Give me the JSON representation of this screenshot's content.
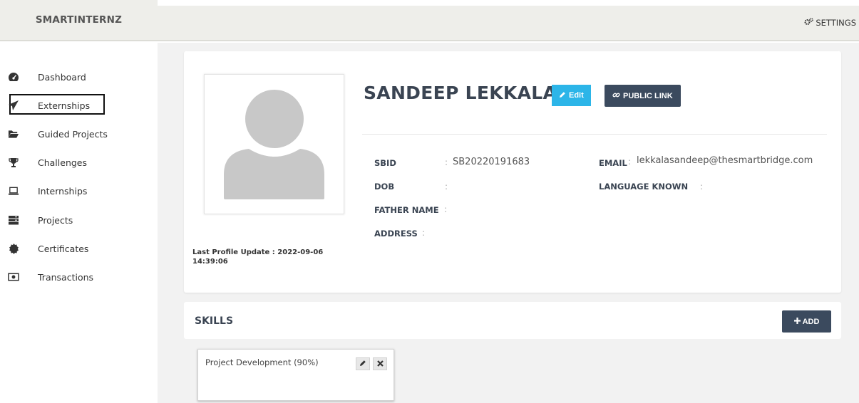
{
  "brand": "SMARTINTERNZ",
  "settings_label": "SETTINGS",
  "nav": [
    {
      "label": "Dashboard",
      "icon": "dashboard-icon"
    },
    {
      "label": "Externships",
      "icon": "paper-plane-icon"
    },
    {
      "label": "Guided Projects",
      "icon": "folder-open-icon"
    },
    {
      "label": "Challenges",
      "icon": "trophy-icon"
    },
    {
      "label": "Internships",
      "icon": "laptop-icon"
    },
    {
      "label": "Projects",
      "icon": "server-icon"
    },
    {
      "label": "Certificates",
      "icon": "badge-icon"
    },
    {
      "label": "Transactions",
      "icon": "money-icon"
    }
  ],
  "active_nav": "Externships",
  "profile": {
    "name": "SANDEEP LEKKALA",
    "edit_label": "Edit",
    "public_link_label": "PUBLIC LINK",
    "last_update": "Last Profile Update : 2022-09-06 14:39:06",
    "fields": {
      "sbid_label": "SBID",
      "sbid_value": "SB20220191683",
      "dob_label": "DOB",
      "dob_value": "",
      "father_label": "FATHER NAME",
      "father_value": "",
      "address_label": "ADDRESS",
      "address_value": "",
      "email_label": "EMAIL",
      "email_value": "lekkalasandeep@thesmartbridge.com",
      "language_label": "LANGUAGE KNOWN",
      "language_value": ""
    },
    "colon": ":"
  },
  "skills": {
    "title": "SKILLS",
    "add_label": "ADD",
    "items": [
      {
        "name": "Project Development (90%)"
      }
    ]
  },
  "colors": {
    "edit_button": "#2cb5e8",
    "dark_button": "#3b4a5e",
    "header_bg": "#eeeeea",
    "main_bg": "#f2f2f2"
  }
}
